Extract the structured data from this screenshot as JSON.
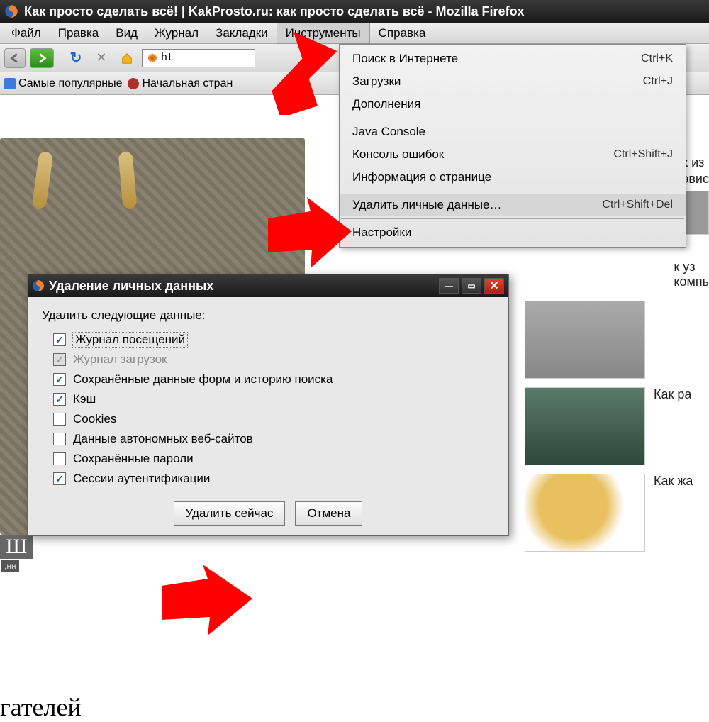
{
  "window": {
    "title": "Как просто сделать всё! | KakProsto.ru: как просто сделать всё - Mozilla Firefox"
  },
  "menubar": {
    "file": "Файл",
    "edit": "Правка",
    "view": "Вид",
    "history": "Журнал",
    "bookmarks": "Закладки",
    "tools": "Инструменты",
    "help": "Справка"
  },
  "toolbar": {
    "url_fragment": "ht"
  },
  "bookmarks": {
    "popular": "Самые популярные",
    "start_page": "Начальная стран"
  },
  "tools_menu": {
    "items": [
      {
        "label": "Поиск в Интернете",
        "shortcut": "Ctrl+K"
      },
      {
        "label": "Загрузки",
        "shortcut": "Ctrl+J"
      },
      {
        "label": "Дополнения",
        "shortcut": ""
      },
      {
        "sep": true
      },
      {
        "label": "Java Console",
        "shortcut": ""
      },
      {
        "label": "Консоль ошибок",
        "shortcut": "Ctrl+Shift+J"
      },
      {
        "label": "Информация о странице",
        "shortcut": ""
      },
      {
        "sep": true
      },
      {
        "label": "Удалить личные данные…",
        "shortcut": "Ctrl+Shift+Del",
        "hl": true
      },
      {
        "sep": true
      },
      {
        "label": "Настройки",
        "shortcut": ""
      }
    ]
  },
  "dialog": {
    "title": "Удаление личных данных",
    "heading": "Удалить следующие данные:",
    "options": [
      {
        "label": "Журнал посещений",
        "checked": true,
        "focused": true
      },
      {
        "label": "Журнал загрузок",
        "checked": true,
        "disabled": true
      },
      {
        "label": "Сохранённые данные форм и историю поиска",
        "checked": true
      },
      {
        "label": "Кэш",
        "checked": true
      },
      {
        "label": "Cookies",
        "checked": false
      },
      {
        "label": "Данные автономных веб-сайтов",
        "checked": false
      },
      {
        "label": "Сохранённые пароли",
        "checked": false
      },
      {
        "label": "Сессии аутентификации",
        "checked": true
      }
    ],
    "ok": "Удалить сейчас",
    "cancel": "Отмена"
  },
  "page": {
    "letters_overlay": "Ш",
    "tiny_caption": ",нн",
    "bottom_fragment": "гателей",
    "side_text_1": "к из",
    "side_text_2": "эвис",
    "side_text_3": "к уз",
    "side_text_4": "компь",
    "side_label_2": "Как ра",
    "side_label_3": "Как жа"
  }
}
